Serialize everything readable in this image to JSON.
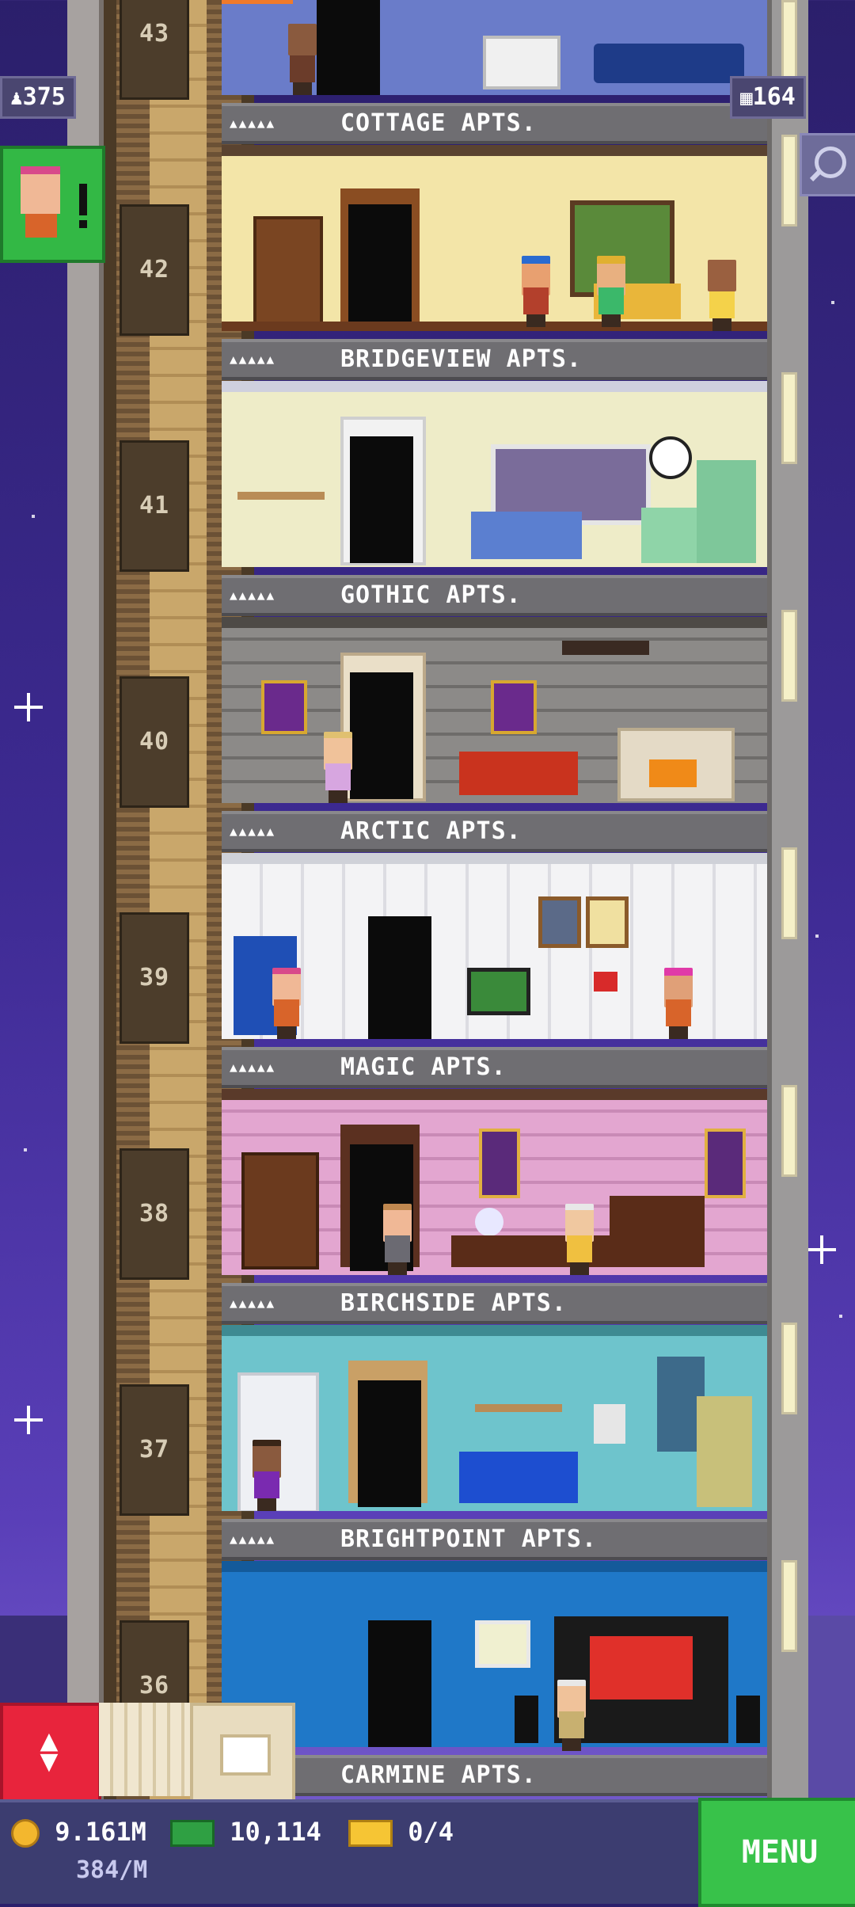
{
  "hud": {
    "population": "375",
    "floors_count": "164"
  },
  "floors": [
    {
      "number": "43",
      "name": "COTTAGE APTS."
    },
    {
      "number": "42",
      "name": "BRIDGEVIEW APTS."
    },
    {
      "number": "41",
      "name": "GOTHIC APTS."
    },
    {
      "number": "40",
      "name": "ARCTIC APTS."
    },
    {
      "number": "39",
      "name": "MAGIC APTS."
    },
    {
      "number": "38",
      "name": "BIRCHSIDE APTS."
    },
    {
      "number": "37",
      "name": "BRIGHTPOINT APTS."
    },
    {
      "number": "36",
      "name": "CARMINE APTS."
    }
  ],
  "resident_dots": "▲▲▲▲▲",
  "bottom": {
    "coins": "9.161M",
    "coins_rate": "384/M",
    "bux": "10,114",
    "tickets": "0/4",
    "menu_label": "MENU"
  },
  "colors": {
    "menu_green": "#38c24a",
    "elevator_red": "#e8243c",
    "notification_green": "#33b845"
  }
}
